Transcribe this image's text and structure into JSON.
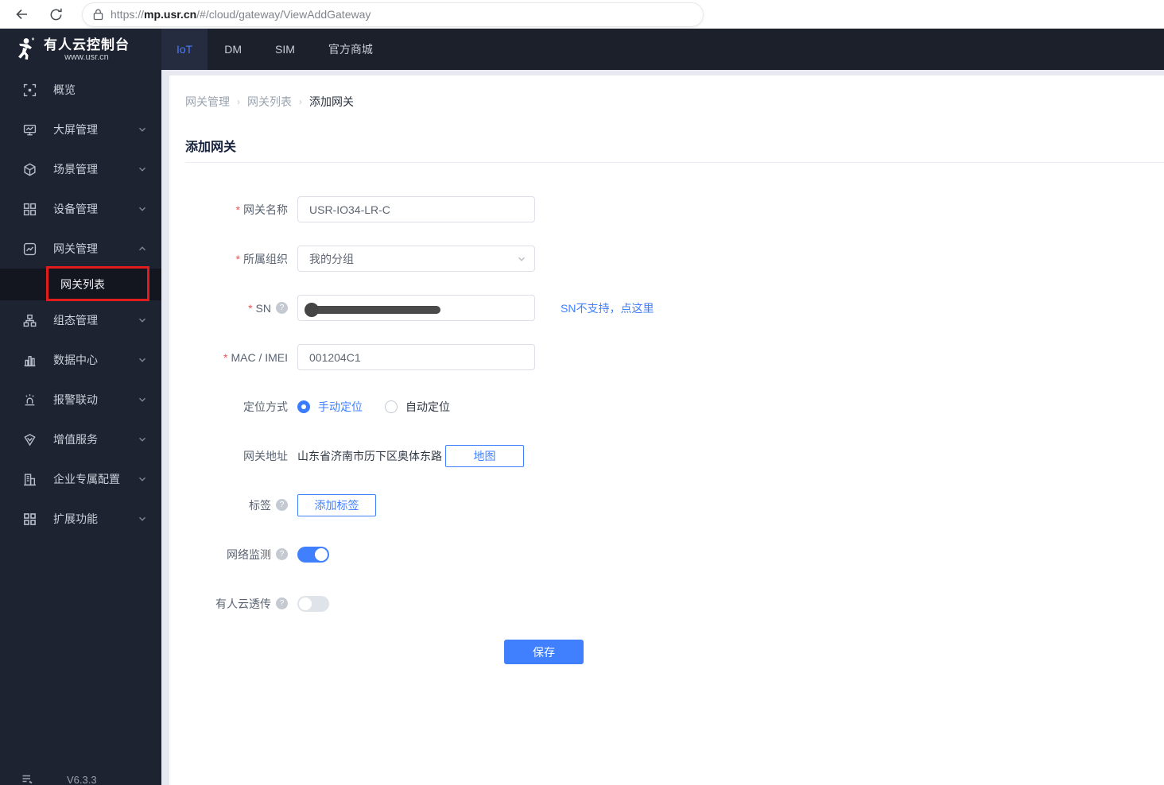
{
  "browser": {
    "url_scheme": "https://",
    "url_host": "mp.usr.cn",
    "url_path": "/#/cloud/gateway/ViewAddGateway"
  },
  "brand": {
    "title": "有人云控制台",
    "subtitle": "www.usr.cn"
  },
  "topnav": {
    "tabs": [
      {
        "label": "IoT",
        "active": true
      },
      {
        "label": "DM",
        "active": false
      },
      {
        "label": "SIM",
        "active": false
      },
      {
        "label": "官方商城",
        "active": false
      }
    ]
  },
  "sidebar": {
    "items": [
      {
        "label": "概览",
        "icon": "overview-icon",
        "expandable": false
      },
      {
        "label": "大屏管理",
        "icon": "screen-icon",
        "expandable": true
      },
      {
        "label": "场景管理",
        "icon": "scene-icon",
        "expandable": true
      },
      {
        "label": "设备管理",
        "icon": "device-icon",
        "expandable": true
      },
      {
        "label": "网关管理",
        "icon": "gateway-icon",
        "expandable": true,
        "expanded": true
      },
      {
        "label": "组态管理",
        "icon": "scada-icon",
        "expandable": true
      },
      {
        "label": "数据中心",
        "icon": "data-center-icon",
        "expandable": true
      },
      {
        "label": "报警联动",
        "icon": "alarm-icon",
        "expandable": true
      },
      {
        "label": "增值服务",
        "icon": "value-service-icon",
        "expandable": true
      },
      {
        "label": "企业专属配置",
        "icon": "enterprise-icon",
        "expandable": true
      },
      {
        "label": "扩展功能",
        "icon": "extension-icon",
        "expandable": true
      }
    ],
    "submenu": {
      "label": "网关列表",
      "active": true,
      "annotated": true
    },
    "version": "V6.3.3"
  },
  "breadcrumb": {
    "items": [
      "网关管理",
      "网关列表",
      "添加网关"
    ]
  },
  "page": {
    "title": "添加网关"
  },
  "form": {
    "gateway_name": {
      "label": "网关名称",
      "required": true,
      "value": "USR-IO34-LR-C"
    },
    "organization": {
      "label": "所属组织",
      "required": true,
      "value": "我的分组"
    },
    "sn": {
      "label": "SN",
      "required": true,
      "has_help": true,
      "value_masked": true,
      "side_link": "SN不支持，点这里"
    },
    "mac": {
      "label": "MAC / IMEI",
      "required": true,
      "value": "001204C1"
    },
    "location_mode": {
      "label": "定位方式",
      "options": [
        {
          "label": "手动定位",
          "selected": true
        },
        {
          "label": "自动定位",
          "selected": false
        }
      ]
    },
    "address": {
      "label": "网关地址",
      "value": "山东省济南市历下区奥体东路",
      "map_button": "地图"
    },
    "tags": {
      "label": "标签",
      "has_help": true,
      "add_button": "添加标签"
    },
    "network_monitor": {
      "label": "网络监测",
      "has_help": true,
      "enabled": true
    },
    "cloud_passthrough": {
      "label": "有人云透传",
      "has_help": true,
      "enabled": false
    },
    "help_glyph": "?",
    "save_button": "保存"
  },
  "colors": {
    "accent": "#4080ff",
    "sidebar_bg": "#1d2330",
    "topnav_bg": "#1b202b",
    "active_tab_bg": "#262c3f",
    "submenu_bg": "#13161e",
    "annotation_red": "#e11c1c",
    "content_bg": "#e6e9f0"
  }
}
